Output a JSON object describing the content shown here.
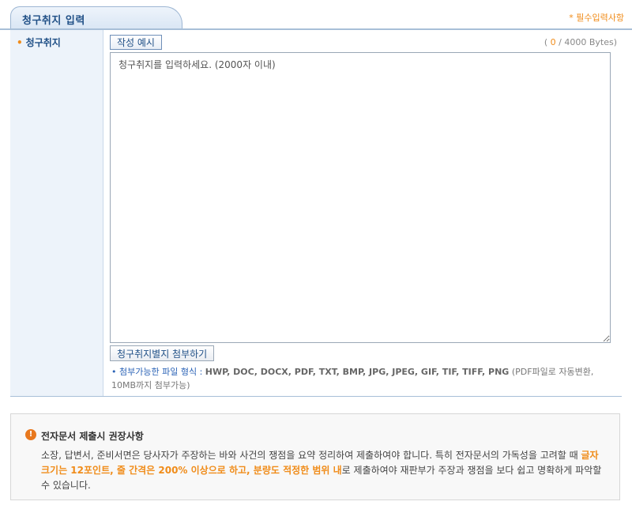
{
  "header": {
    "title": "청구취지 입력",
    "required_note": "* 필수입력사항"
  },
  "form": {
    "row_label": "청구취지",
    "example_button": "작성 예시",
    "byte_counter": {
      "open": "( ",
      "count": "0",
      "rest": " / 4000 Bytes)"
    },
    "textarea": {
      "placeholder": "청구취지를 입력하세요. (2000자 이내)",
      "value": ""
    },
    "attach_button": "청구취지별지 첨부하기",
    "file_info": {
      "bullet": "•",
      "label": "첨부가능한 파일 형식 :",
      "formats": "HWP, DOC, DOCX, PDF, TXT, BMP, JPG, JPEG, GIF, TIF, TIFF, PNG",
      "note": "(PDF파일로 자동변환, 10MB까지 첨부가능)"
    }
  },
  "notice": {
    "icon": "warning-icon",
    "title": "전자문서 제출시 권장사항",
    "body_part1": "소장, 답변서, 준비서면은 당사자가 주장하는 바와 사건의 쟁점을 요약 정리하여 제출하여야 합니다. 특히 전자문서의 가독성을 고려할 때 ",
    "body_highlight": "글자 크기는 12포인트, 줄 간격은 200% 이상으로 하고, 분량도 적정한 범위 내",
    "body_part2": "로 제출하여야 재판부가 주장과 쟁점을 보다 쉽고 명확하게 파악할 수 있습니다."
  },
  "colors": {
    "accent": "#1f4f86",
    "highlight": "#f08c1a",
    "border": "#a8bfd8"
  }
}
